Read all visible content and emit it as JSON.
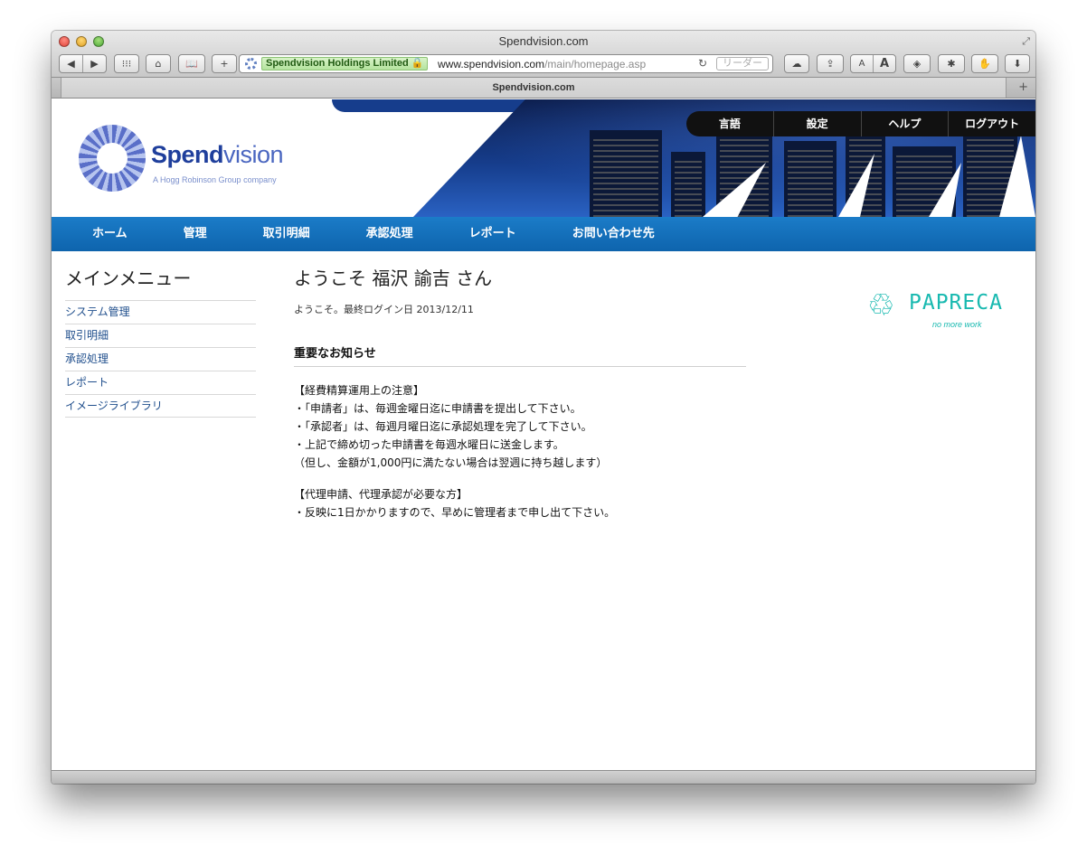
{
  "window": {
    "title": "Spendvision.com",
    "tab_title": "Spendvision.com",
    "address": {
      "ev_label": "Spendvision Holdings Limited 🔒",
      "url_host": "www.spendvision.com",
      "url_path": "/main/homepage.asp",
      "reader_label": "リーダー"
    },
    "toolbar": {
      "back": "◀",
      "forward": "▶",
      "grid": "⁝⁝⁝",
      "home": "⌂",
      "bookmarks": "📖",
      "add": "+",
      "cloud": "☁",
      "share": "⇪",
      "font_small": "A",
      "font_large": "A",
      "reload": "↻"
    }
  },
  "brand": {
    "word_bold": "Spend",
    "word_light": "vision",
    "tagline": "A Hogg Robinson Group company",
    "accent": "#0e64ad"
  },
  "top_nav": [
    "言語",
    "設定",
    "ヘルプ",
    "ログアウト"
  ],
  "main_nav": [
    "ホーム",
    "管理",
    "取引明細",
    "承認処理",
    "レポート",
    "お問い合わせ先"
  ],
  "sidebar": {
    "title": "メインメニュー",
    "items": [
      "システム管理",
      "取引明細",
      "承認処理",
      "レポート",
      "イメージライブラリ"
    ]
  },
  "main": {
    "welcome": "ようこそ 福沢 諭吉 さん",
    "last_login": "ようこそ。最終ログイン日 2013/12/11",
    "notice_title": "重要なお知らせ",
    "notice_lines": [
      "【経費精算運用上の注意】",
      "・「申請者」は、毎週金曜日迄に申請書を提出して下さい。",
      "・「承認者」は、毎週月曜日迄に承認処理を完了して下さい。",
      "・上記で締め切った申請書を毎週水曜日に送金します。",
      "（但し、金額が1,000円に満たない場合は翌週に持ち越します）"
    ],
    "notice_lines_2": [
      "【代理申請、代理承認が必要な方】",
      "・反映に1日かかりますので、早めに管理者まで申し出て下さい。"
    ]
  },
  "papreca": {
    "word": "PAPRECA",
    "tagline": "no more work",
    "color": "#18b9b0"
  }
}
